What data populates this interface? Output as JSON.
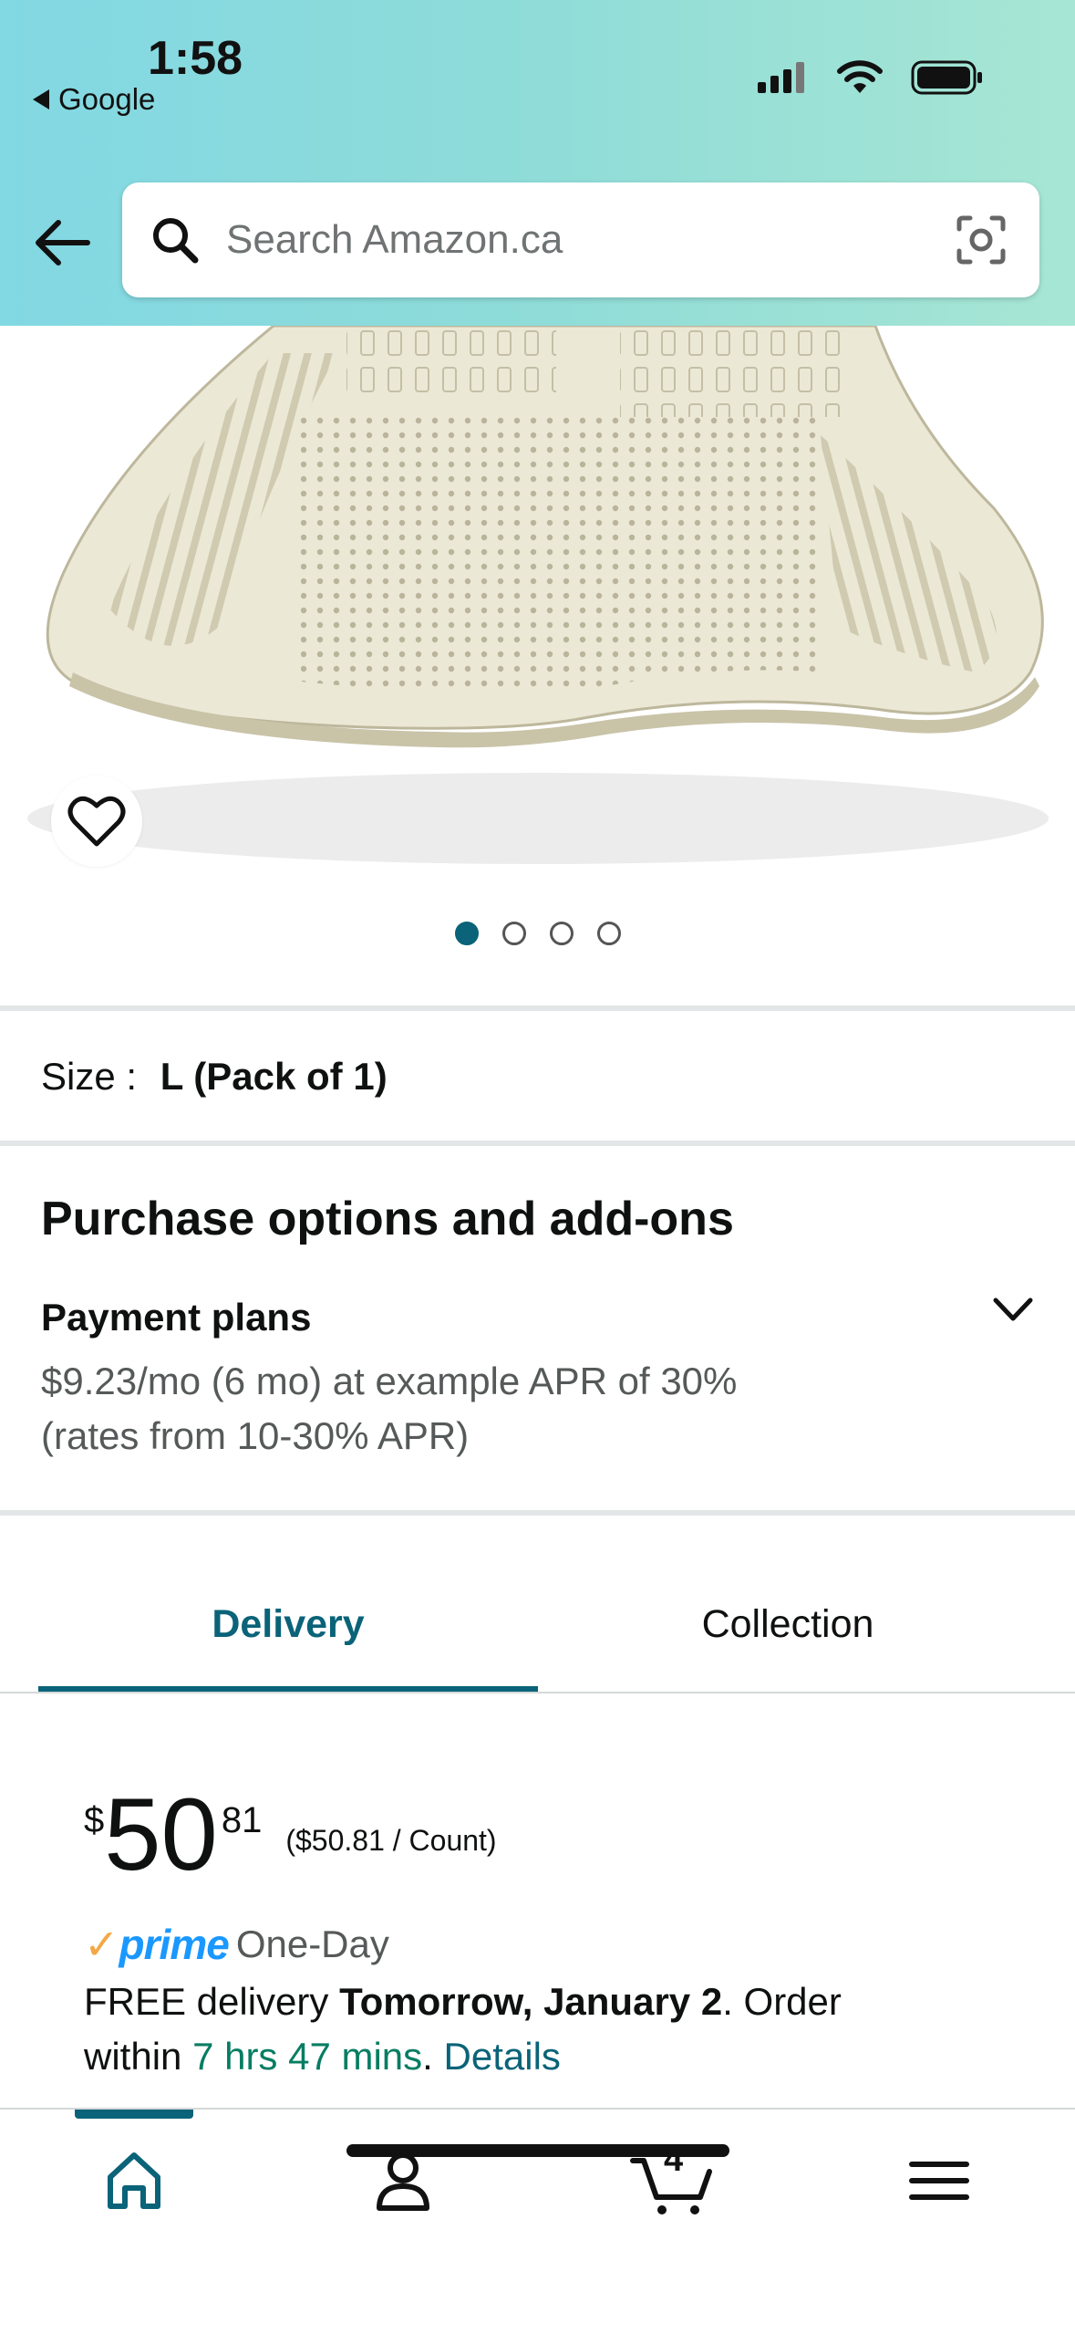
{
  "status_bar": {
    "time": "1:58",
    "back_app": "Google"
  },
  "search": {
    "placeholder": "Search Amazon.ca"
  },
  "gallery": {
    "image_count": 4,
    "active_index": 0
  },
  "size": {
    "label": "Size :",
    "value": "L (Pack of 1)"
  },
  "purchase_options": {
    "title": "Purchase options and add-ons",
    "payment_plans_title": "Payment plans",
    "payment_plans_line1": "$9.23/mo (6 mo) at example APR of 30%",
    "payment_plans_line2": "(rates from 10-30% APR)"
  },
  "tabs": {
    "delivery": "Delivery",
    "collection": "Collection",
    "active": "Delivery"
  },
  "price": {
    "currency": "$",
    "whole": "50",
    "fraction": "81",
    "per_unit": "($50.81 / Count)"
  },
  "prime": {
    "check": "✓",
    "word": "prime",
    "tier": "One-Day"
  },
  "delivery": {
    "free_text": "FREE delivery ",
    "date": "Tomorrow, January 2",
    "order_text": ". Order",
    "within_text": "within ",
    "countdown": "7 hrs 47 mins",
    "period": ".",
    "details_link": "Details"
  },
  "bottom_nav": {
    "cart_count": "4"
  },
  "colors": {
    "accent": "#0a6378",
    "prime_blue": "#1a98ff",
    "green": "#067d62",
    "header_start": "#82d8e3",
    "header_end": "#a7e6d4"
  }
}
